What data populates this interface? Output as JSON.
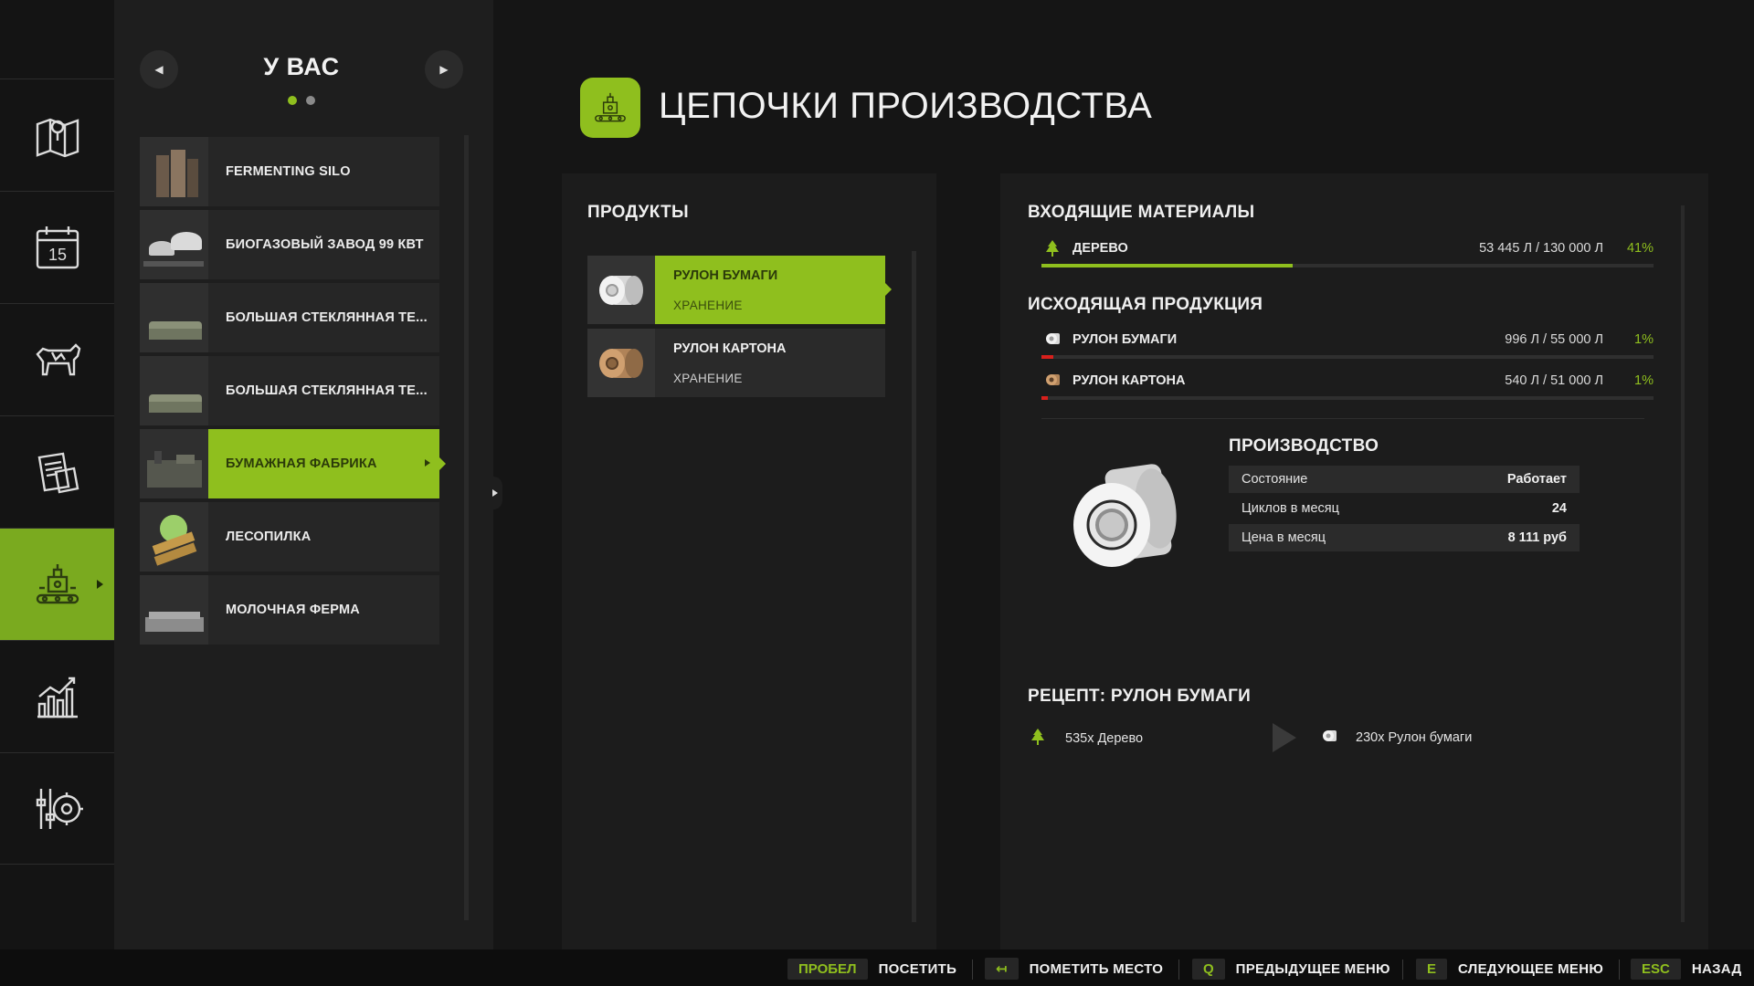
{
  "nav": {
    "items": [
      {
        "icon": "map-icon"
      },
      {
        "icon": "calendar-icon",
        "text": "15"
      },
      {
        "icon": "animals-icon"
      },
      {
        "icon": "contracts-icon"
      },
      {
        "icon": "production-icon"
      },
      {
        "icon": "statistics-icon"
      },
      {
        "icon": "settings-icon"
      }
    ]
  },
  "facilities": {
    "title": "У ВАС",
    "items": [
      {
        "label": "FERMENTING SILO"
      },
      {
        "label": "БИОГАЗОВЫЙ ЗАВОД 99 КВТ"
      },
      {
        "label": "БОЛЬШАЯ СТЕКЛЯННАЯ ТЕ..."
      },
      {
        "label": "БОЛЬШАЯ СТЕКЛЯННАЯ ТЕ..."
      },
      {
        "label": "БУМАЖНАЯ ФАБРИКА"
      },
      {
        "label": "ЛЕСОПИЛКА"
      },
      {
        "label": "МОЛОЧНАЯ ФЕРМА"
      }
    ]
  },
  "header": {
    "title": "ЦЕПОЧКИ ПРОИЗВОДСТВА"
  },
  "products": {
    "heading": "ПРОДУКТЫ",
    "items": [
      {
        "name": "РУЛОН БУМАГИ",
        "sub": "ХРАНЕНИЕ"
      },
      {
        "name": "РУЛОН КАРТОНА",
        "sub": "ХРАНЕНИЕ"
      }
    ]
  },
  "details": {
    "inputs_heading": "ВХОДЯЩИЕ МАТЕРИАЛЫ",
    "inputs": [
      {
        "name": "ДЕРЕВО",
        "amount": "53 445 Л / 130 000 Л",
        "pct": "41%",
        "fill": 0.41,
        "bar_color": "#8fbf1e"
      }
    ],
    "outputs_heading": "ИСХОДЯЩАЯ ПРОДУКЦИЯ",
    "outputs": [
      {
        "name": "РУЛОН БУМАГИ",
        "amount": "996 Л / 55 000 Л",
        "pct": "1%",
        "fill": 0.02,
        "bar_color": "#d8201c"
      },
      {
        "name": "РУЛОН КАРТОНА",
        "amount": "540 Л / 51 000 Л",
        "pct": "1%",
        "fill": 0.01,
        "bar_color": "#d8201c"
      }
    ],
    "production_heading": "ПРОИЗВОДСТВО",
    "production": [
      {
        "k": "Состояние",
        "v": "Работает"
      },
      {
        "k": "Циклов в месяц",
        "v": "24"
      },
      {
        "k": "Цена в месяц",
        "v": "8 111 руб"
      }
    ],
    "recipe_heading": "РЕЦЕПТ: РУЛОН БУМАГИ",
    "recipe_input": "535x Дерево",
    "recipe_output": "230x Рулон бумаги"
  },
  "hints": [
    {
      "key": "ПРОБЕЛ",
      "label": "ПОСЕТИТЬ"
    },
    {
      "key": "↤",
      "label": "ПОМЕТИТЬ МЕСТО"
    },
    {
      "key": "Q",
      "label": "ПРЕДЫДУЩЕЕ МЕНЮ"
    },
    {
      "key": "E",
      "label": "СЛЕДУЮЩЕЕ МЕНЮ"
    },
    {
      "key": "ESC",
      "label": "НАЗАД"
    }
  ],
  "colors": {
    "accent": "#8fbf1e",
    "low_stock": "#d8201c"
  }
}
